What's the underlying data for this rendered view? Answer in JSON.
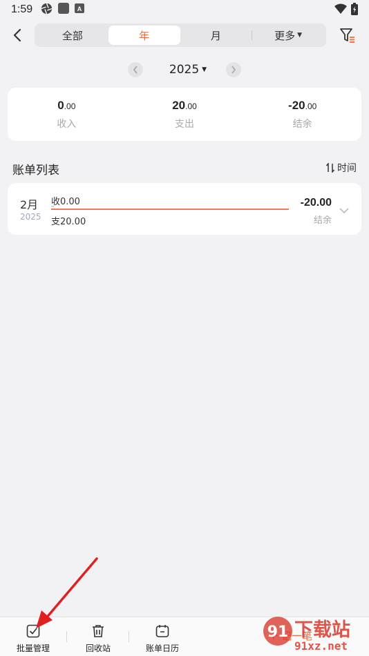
{
  "status_bar": {
    "time": "1:59"
  },
  "header": {
    "tabs": [
      {
        "label": "全部",
        "active": false
      },
      {
        "label": "年",
        "active": true
      },
      {
        "label": "月",
        "active": false
      },
      {
        "label": "更多",
        "active": false
      }
    ]
  },
  "year_selector": {
    "year": "2025"
  },
  "summary": {
    "income": {
      "int": "0",
      "dec": ".00",
      "label": "收入"
    },
    "expense": {
      "int": "20",
      "dec": ".00",
      "label": "支出"
    },
    "balance": {
      "int": "-20",
      "dec": ".00",
      "label": "结余"
    }
  },
  "list": {
    "title": "账单列表",
    "sort_label": "时间",
    "items": [
      {
        "month": "2月",
        "year": "2025",
        "income_text": "收0.00",
        "expense_text": "支20.00",
        "expense_ratio": 1.0,
        "balance": "-20.00",
        "balance_label": "结余"
      }
    ]
  },
  "bottom_bar": {
    "batch_label": "批量管理",
    "recycle_label": "回收站",
    "calendar_label": "账单日历",
    "add_label": "记一笔"
  },
  "watermark": {
    "brand_text": "下载站",
    "domain_text": "91xz.net"
  },
  "colors": {
    "accent": "#f06a3c",
    "annotation": "#e02020"
  }
}
